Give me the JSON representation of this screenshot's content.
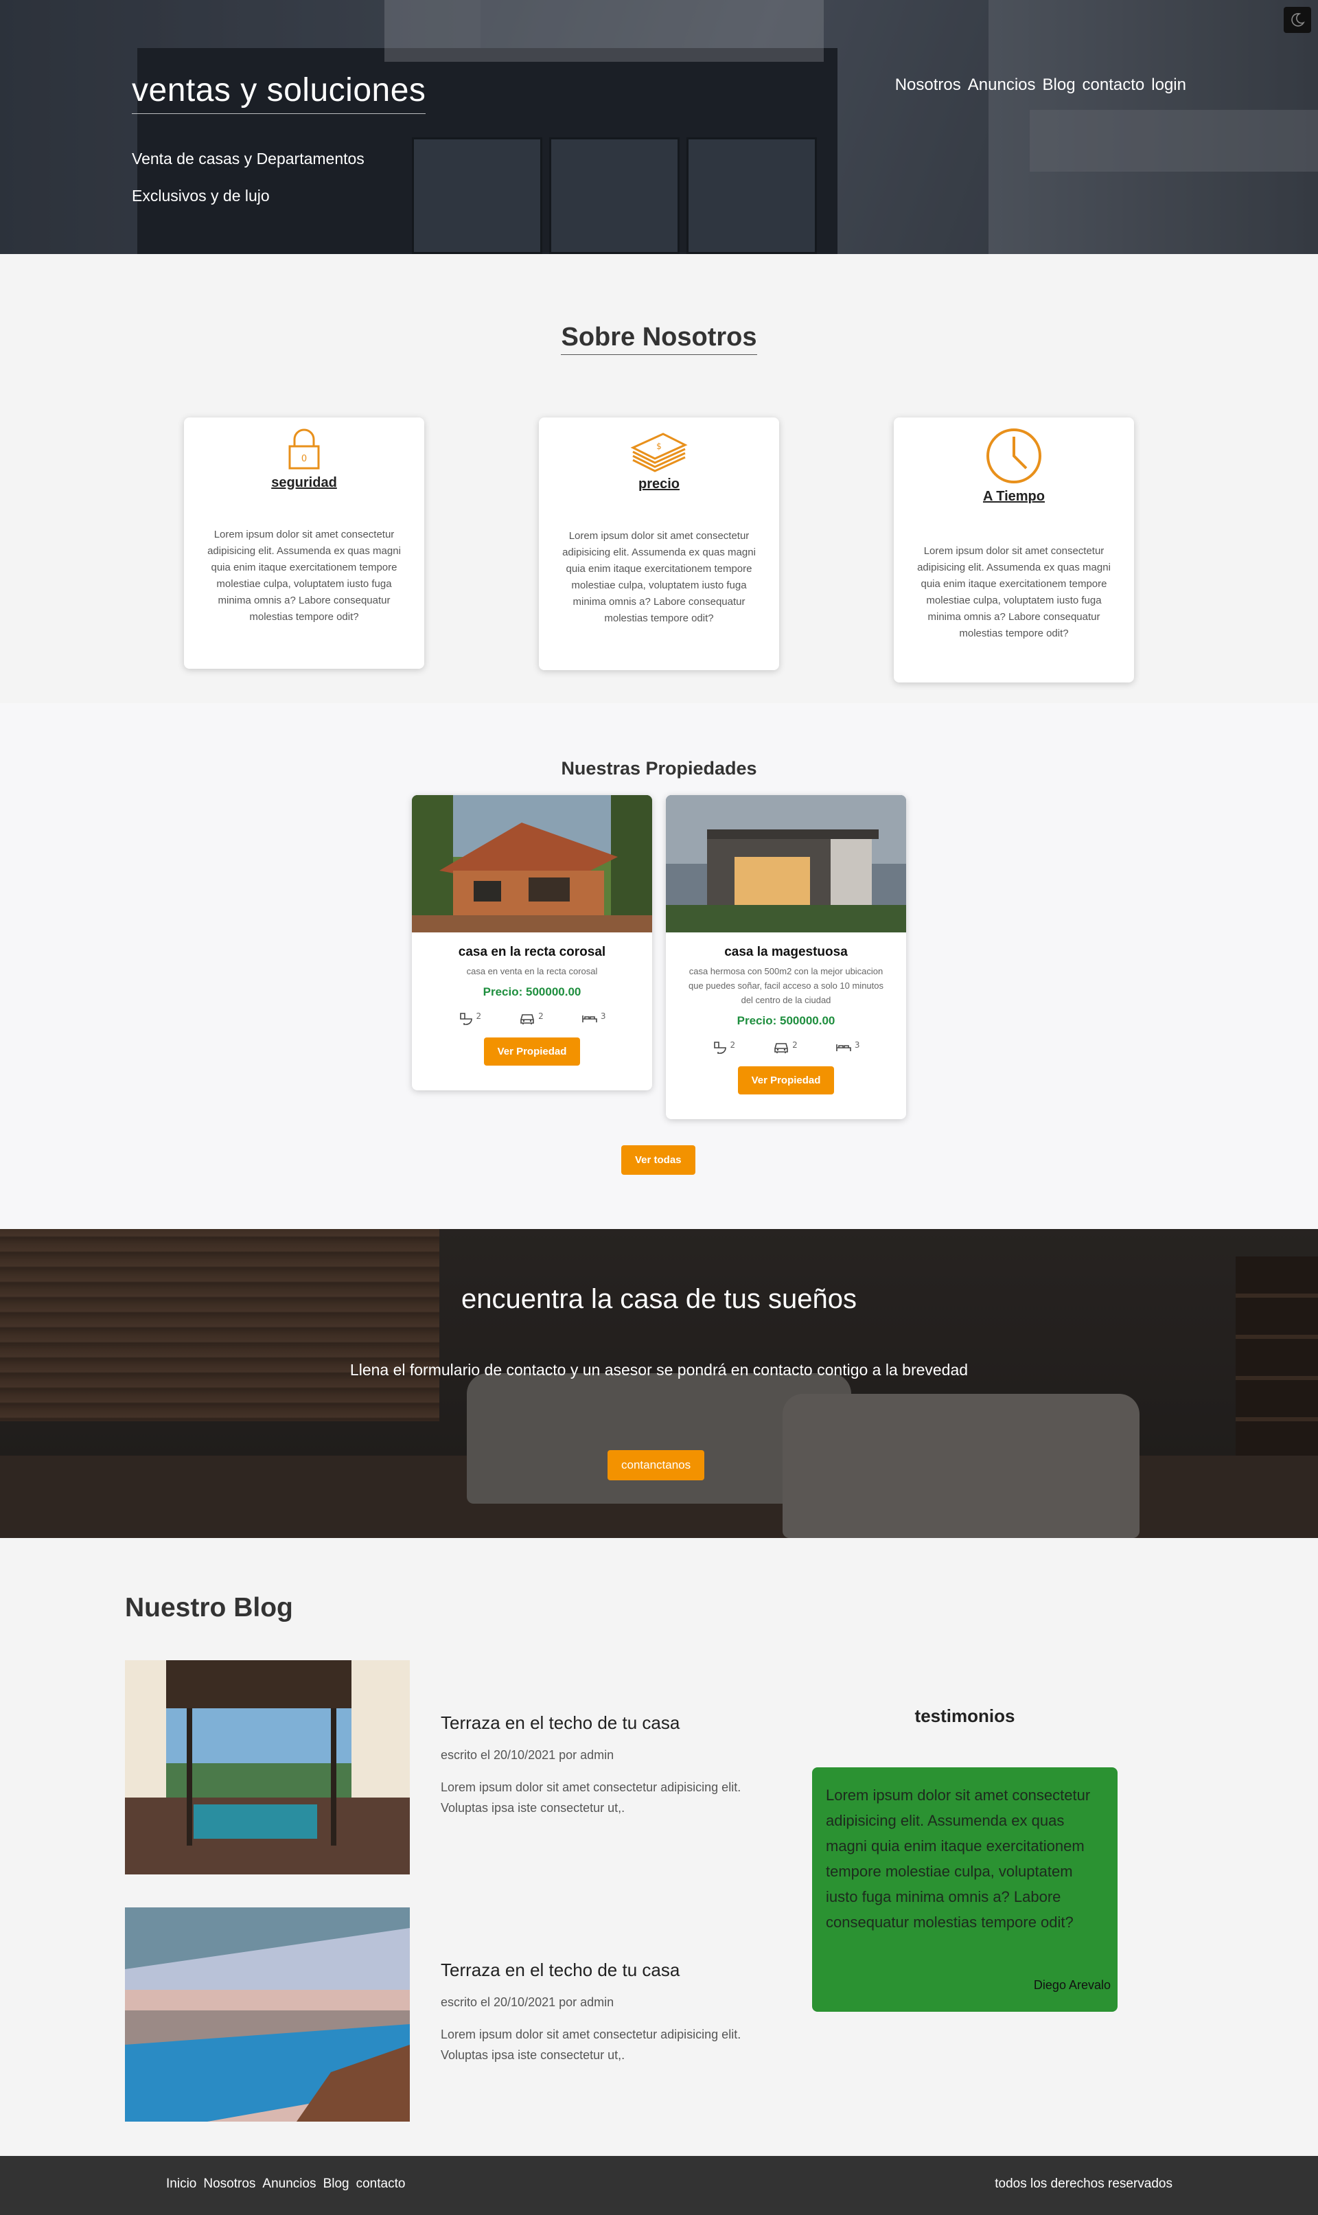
{
  "header": {
    "brand": "ventas y soluciones",
    "tagline_1": "Venta de casas y Departamentos",
    "tagline_2": "Exclusivos y de lujo",
    "nav": [
      "Nosotros",
      "Anuncios",
      "Blog",
      "contacto",
      "login"
    ],
    "dark_mode_icon": "moon-icon"
  },
  "about": {
    "title": "Sobre Nosotros",
    "cards": [
      {
        "icon": "lock-icon",
        "title": "seguridad",
        "text": "Lorem ipsum dolor sit amet consectetur adipisicing elit. Assumenda ex quas magni quia enim itaque exercitationem tempore molestiae culpa, voluptatem iusto fuga minima omnis a? Labore consequatur molestias tempore odit?"
      },
      {
        "icon": "money-icon",
        "title": "precio",
        "text": "Lorem ipsum dolor sit amet consectetur adipisicing elit. Assumenda ex quas magni quia enim itaque exercitationem tempore molestiae culpa, voluptatem iusto fuga minima omnis a? Labore consequatur molestias tempore odit?"
      },
      {
        "icon": "clock-icon",
        "title": "A Tiempo",
        "text": "Lorem ipsum dolor sit amet consectetur adipisicing elit. Assumenda ex quas magni quia enim itaque exercitationem tempore molestiae culpa, voluptatem iusto fuga minima omnis a? Labore consequatur molestias tempore odit?"
      }
    ]
  },
  "properties": {
    "title": "Nuestras Propiedades",
    "items": [
      {
        "name": "casa en la recta corosal",
        "description": "casa en venta en la recta corosal",
        "price": "Precio: 500000.00",
        "baths": "2",
        "parking": "2",
        "rooms": "3",
        "button": "Ver Propiedad"
      },
      {
        "name": "casa la magestuosa",
        "description": "casa hermosa con 500m2 con la mejor ubicacion que puedes soñar, facil acceso a solo 10 minutos del centro de la ciudad",
        "price": "Precio: 500000.00",
        "baths": "2",
        "parking": "2",
        "rooms": "3",
        "button": "Ver Propiedad"
      }
    ],
    "view_all": "Ver todas"
  },
  "cta": {
    "title": "encuentra la casa de tus sueños",
    "text": "Llena el formulario de contacto y un asesor se pondrá en contacto contigo a la brevedad",
    "button": "contanctanos"
  },
  "blog": {
    "title": "Nuestro Blog",
    "posts": [
      {
        "title": "Terraza en el techo de tu casa",
        "meta": "escrito el 20/10/2021 por admin",
        "excerpt": "Lorem ipsum dolor sit amet consectetur adipisicing elit. Voluptas ipsa iste consectetur ut,."
      },
      {
        "title": "Terraza en el techo de tu casa",
        "meta": "escrito el 20/10/2021 por admin",
        "excerpt": "Lorem ipsum dolor sit amet consectetur adipisicing elit. Voluptas ipsa iste consectetur ut,."
      }
    ],
    "testimonials_title": "testimonios",
    "testimonial": {
      "text": "Lorem ipsum dolor sit amet consectetur adipisicing elit. Assumenda ex quas magni quia enim itaque exercitationem tempore molestiae culpa, voluptatem iusto fuga minima omnis a? Labore consequatur molestias tempore odit?",
      "author": "Diego Arevalo"
    }
  },
  "footer": {
    "nav": [
      "Inicio",
      "Nosotros",
      "Anuncios",
      "Blog",
      "contacto"
    ],
    "copyright": "todos los derechos reservados"
  },
  "colors": {
    "accent": "#f39200",
    "price": "#1e8e3e",
    "testimonial_bg": "#2b9232",
    "footer_bg": "#333333"
  }
}
